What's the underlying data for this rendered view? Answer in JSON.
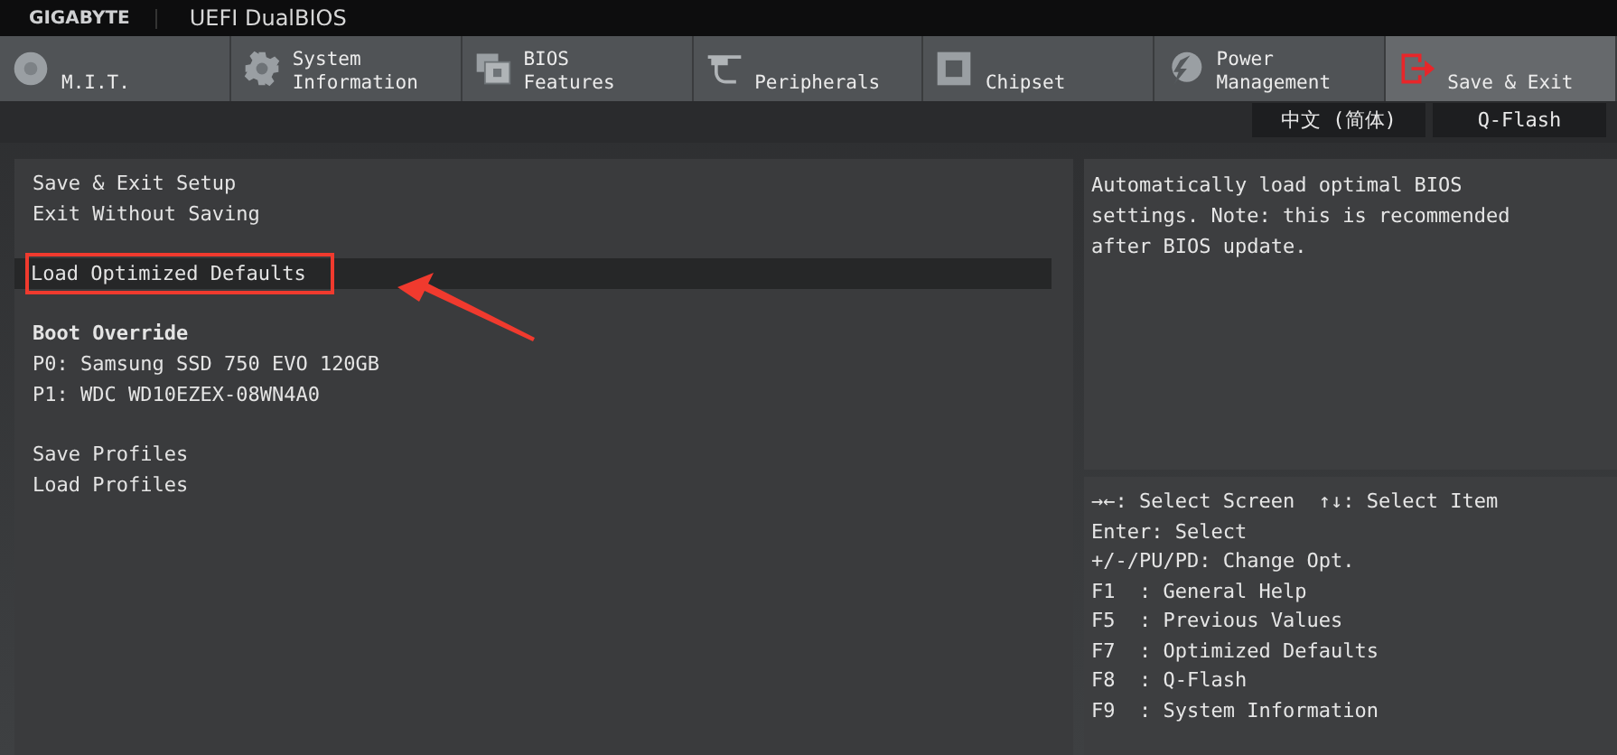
{
  "header": {
    "brand": "GIGABYTE",
    "title": "UEFI DualBIOS"
  },
  "tabs": [
    {
      "label": "M.I.T.",
      "kind": "disc",
      "selected": false
    },
    {
      "label": "System Information",
      "kind": "gear",
      "selected": false
    },
    {
      "label": "BIOS Features",
      "kind": "chip-stack",
      "selected": false
    },
    {
      "label": "Peripherals",
      "kind": "plug",
      "selected": false
    },
    {
      "label": "Chipset",
      "kind": "chip",
      "selected": false
    },
    {
      "label": "Power Management",
      "kind": "bolt",
      "selected": false
    },
    {
      "label": "Save & Exit",
      "kind": "exit",
      "selected": true
    }
  ],
  "toolbar": [
    "中文 (简体)",
    "Q-Flash"
  ],
  "menu": [
    [
      {
        "label": "Save & Exit Setup",
        "kind": "item",
        "selected": false,
        "annotated": false
      },
      {
        "label": "Exit Without Saving",
        "kind": "item",
        "selected": false,
        "annotated": false
      }
    ],
    [
      {
        "label": "Load Optimized Defaults",
        "kind": "item",
        "selected": true,
        "annotated": true
      }
    ],
    [
      {
        "label": "Boot Override",
        "kind": "heading",
        "selected": false,
        "annotated": false
      },
      {
        "label": "P0: Samsung SSD 750 EVO 120GB",
        "kind": "item",
        "selected": false,
        "annotated": false
      },
      {
        "label": "P1: WDC WD10EZEX-08WN4A0",
        "kind": "item",
        "selected": false,
        "annotated": false
      }
    ],
    [
      {
        "label": "Save Profiles",
        "kind": "item",
        "selected": false,
        "annotated": false
      },
      {
        "label": "Load Profiles",
        "kind": "item",
        "selected": false,
        "annotated": false
      }
    ]
  ],
  "description": "Automatically load optimal BIOS settings. Note: this is recommended after BIOS update.",
  "help": [
    "→←: Select Screen  ↑↓: Select Item",
    "Enter: Select",
    "+/-/PU/PD: Change Opt.",
    "F1  : General Help",
    "F5  : Previous Values",
    "F7  : Optimized Defaults",
    "F8  : Q-Flash",
    "F9  : System Information"
  ]
}
